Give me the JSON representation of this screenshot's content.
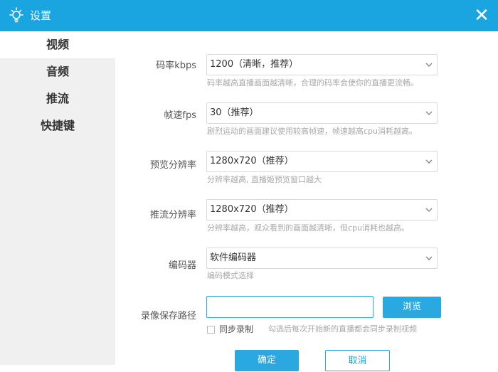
{
  "window": {
    "title": "设置",
    "close_glyph": "✕"
  },
  "sidebar": {
    "items": [
      {
        "label": "视频",
        "active": true
      },
      {
        "label": "音频",
        "active": false
      },
      {
        "label": "推流",
        "active": false
      },
      {
        "label": "快捷键",
        "active": false
      }
    ]
  },
  "settings": {
    "bitrate": {
      "label": "码率kbps",
      "value": "1200（清晰，推荐）",
      "hint": "码率越高直播画面越清晰，合理的码率会使你的直播更流畅。"
    },
    "fps": {
      "label": "帧速fps",
      "value": "30（推荐）",
      "hint": "剧烈运动的画面建议使用较高帧速，帧速越高cpu消耗越高。"
    },
    "preview_resolution": {
      "label": "预览分辨率",
      "value": "1280x720（推荐）",
      "hint": "分辨率越高, 直播姬预览窗口越大"
    },
    "stream_resolution": {
      "label": "推流分辨率",
      "value": "1280x720（推荐）",
      "hint": "分辨率越高，观众看到的画面越清晰，但cpu消耗也越高。"
    },
    "encoder": {
      "label": "编码器",
      "value": "软件编码器",
      "hint": "编码模式选择"
    },
    "record_path": {
      "label": "录像保存路径",
      "value": "",
      "browse_label": "浏览"
    },
    "sync_record": {
      "label": "同步录制",
      "hint": "勾选后每次开始新的直播都会同步录制视频",
      "checked": false
    }
  },
  "footer": {
    "ok_label": "确定",
    "cancel_label": "取消"
  },
  "colors": {
    "accent": "#1ba5e0",
    "sidebar_bg": "#f0f0f0",
    "hint_text": "#a8a8a8"
  },
  "icons": {
    "title": "lightbulb-icon",
    "close": "close-icon",
    "dropdown": "chevron-down-icon"
  }
}
